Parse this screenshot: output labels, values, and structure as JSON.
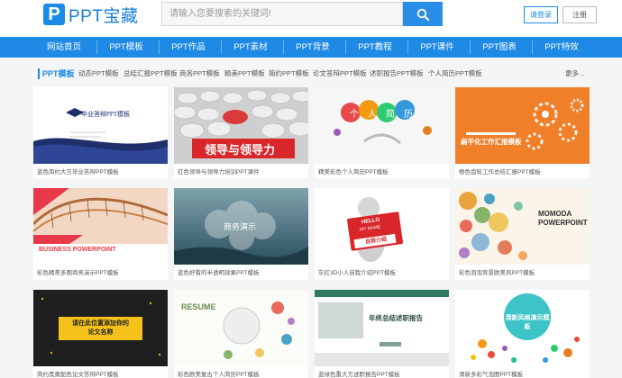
{
  "header": {
    "logo_letter": "P",
    "logo_text": "PPT宝藏",
    "search_placeholder": "请输入您要搜索的关键词!",
    "login_label": "请登录",
    "register_label": "注册"
  },
  "nav": {
    "items": [
      "网站首页",
      "PPT模板",
      "PPT作品",
      "PPT素材",
      "PPT背景",
      "PPT教程",
      "PPT课件",
      "PPT图表",
      "PPT特效"
    ]
  },
  "categories": {
    "title": "PPT模板",
    "items": [
      "动态PPT模板",
      "总结汇报PPT模板",
      "商务PPT模板",
      "精美PPT模板",
      "简约PPT模板",
      "论文答辩PPT模板",
      "述职报告PPT模板",
      "个人简历PPT模板"
    ],
    "more": "更多..."
  },
  "cards": [
    {
      "caption": "蓝色简约大方毕业答辩PPT模板",
      "thumb_title": "毕业答辩PPT模板"
    },
    {
      "caption": "红色领导与领导力培训PPT课件",
      "thumb_title": "领导与领导力"
    },
    {
      "caption": "精美彩色个人简历PPT模板",
      "thumb_chars": [
        "个",
        "人",
        "简",
        "历"
      ]
    },
    {
      "caption": "橙色齿轮工作总结汇报PPT模板",
      "thumb_title": "扁平化工作汇报模板"
    },
    {
      "caption": "彩色精美多图商务演示PPT模板",
      "thumb_title": "BUSINESS POWERPOINT"
    },
    {
      "caption": "蓝色好看的半透明效果PPT模板",
      "thumb_title": "商务演示"
    },
    {
      "caption": "灰红3D小人自我介绍PPT模板",
      "thumb_line1": "HELLO",
      "thumb_line2": "MY NAME",
      "thumb_line3": "自我介绍"
    },
    {
      "caption": "彩色泡泡背景欧美风PPT模板",
      "thumb_line1": "MOMODA",
      "thumb_line2": "POWERPOINT"
    },
    {
      "caption": "简约黑黄配色论文答辩PPT模板",
      "thumb_line1": "请在此位置添加你的",
      "thumb_line2": "论文名称"
    },
    {
      "caption": "彩色欧美复古个人简历PPT模板",
      "thumb_title": "RESUME"
    },
    {
      "caption": "蓝绿色重大方述职报告PPT模板",
      "thumb_title": "年终总结述职报告"
    },
    {
      "caption": "清新多彩气泡图PPT模板",
      "thumb_title": "清新风格演示模板"
    }
  ]
}
